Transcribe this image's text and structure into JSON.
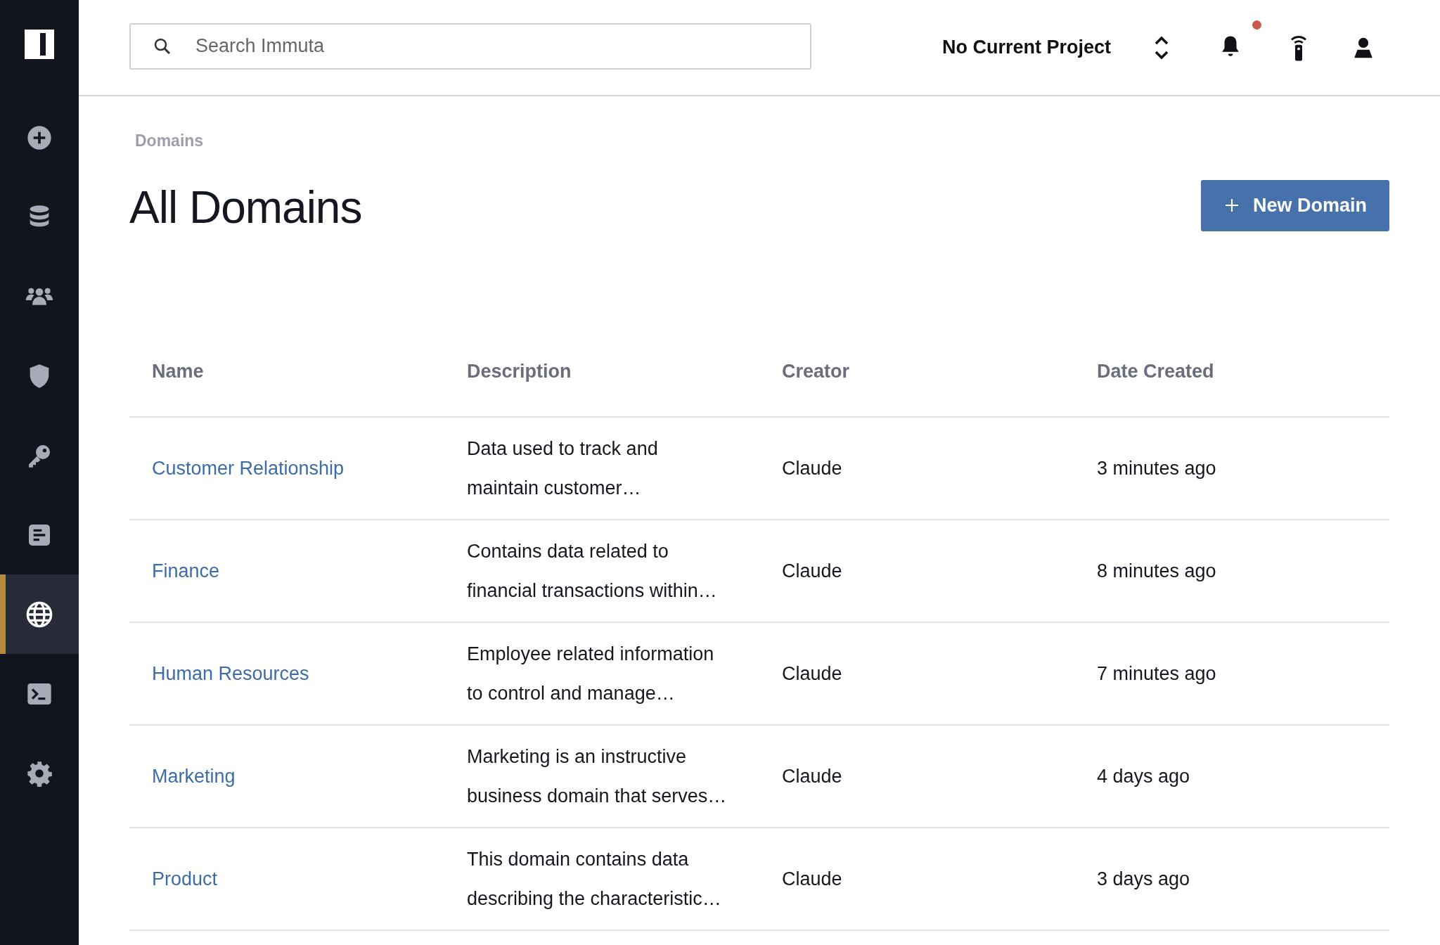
{
  "sidebar": {
    "items": [
      {
        "selected": false
      },
      {
        "selected": false
      },
      {
        "selected": false
      },
      {
        "selected": false
      },
      {
        "selected": false
      },
      {
        "selected": false
      },
      {
        "selected": true
      },
      {
        "selected": false
      },
      {
        "selected": false
      }
    ]
  },
  "search": {
    "placeholder": "Search Immuta"
  },
  "project": {
    "label": "No Current Project"
  },
  "notifications": {
    "unread": true
  },
  "breadcrumb": "Domains",
  "title": "All Domains",
  "new_button": {
    "label": "New Domain"
  },
  "table": {
    "columns": [
      "Name",
      "Description",
      "Creator",
      "Date Created"
    ],
    "rows": [
      {
        "name": "Customer Relationship",
        "description": "Data used to track and maintain customer…",
        "creator": "Claude",
        "date": "3 minutes ago"
      },
      {
        "name": "Finance",
        "description": "Contains data related to financial transactions within…",
        "creator": "Claude",
        "date": "8 minutes ago"
      },
      {
        "name": "Human Resources",
        "description": "Employee related information to control and manage…",
        "creator": "Claude",
        "date": "7 minutes ago"
      },
      {
        "name": "Marketing",
        "description": "Marketing is an instructive business domain that serves…",
        "creator": "Claude",
        "date": "4 days ago"
      },
      {
        "name": "Product",
        "description": "This domain contains data describing the characteristic…",
        "creator": "Claude",
        "date": "3 days ago"
      }
    ]
  }
}
